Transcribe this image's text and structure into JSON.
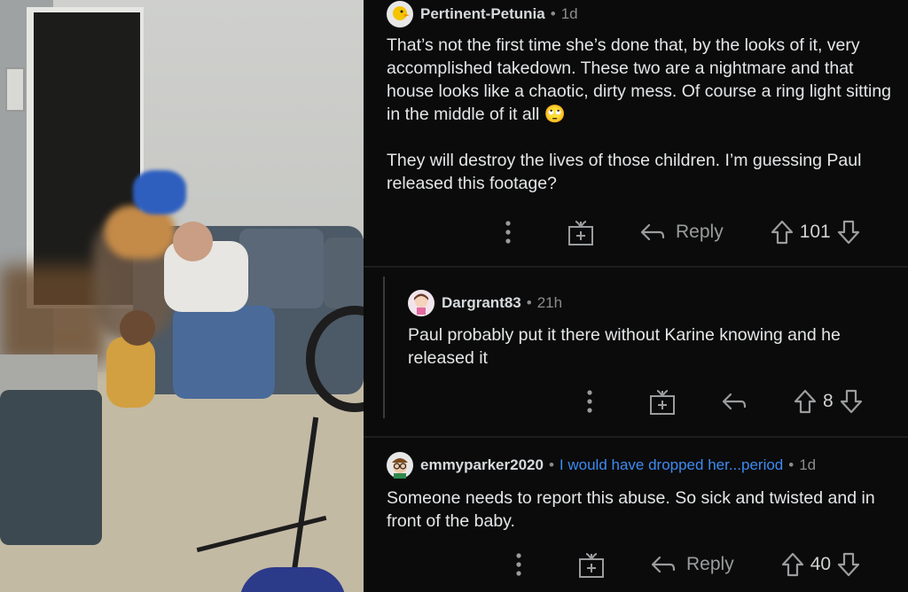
{
  "comments": [
    {
      "username": "Pertinent-Petunia",
      "separator": "•",
      "time": "1d",
      "avatar_icon": "duck-avatar-icon",
      "body_p1": "That’s not the first time she’s done that, by the looks of it, very accomplished takedown. These two are a nightmare and that house looks like a chaotic, dirty mess.  Of course a ring light sitting in the middle of it all",
      "emoji": "🙄",
      "body_p2": "They will destroy the lives of those children. I’m guessing Paul released this footage?",
      "reply_label": "Reply",
      "votes": "101"
    },
    {
      "username": "Dargrant83",
      "separator": "•",
      "time": "21h",
      "avatar_icon": "girl-avatar-icon",
      "body": "Paul probably put it there without Karine knowing and he released it",
      "votes": "8"
    },
    {
      "username": "emmyparker2020",
      "separator": "•",
      "flair": "I would have dropped her...period",
      "time": "1d",
      "avatar_icon": "glasses-avatar-icon",
      "body": "Someone needs to report this abuse. So sick and twisted and in front of the baby.",
      "reply_label": "Reply",
      "votes": "40"
    }
  ],
  "colors": {
    "background": "#0b0b0b",
    "text": "#e4e6e8",
    "muted": "#8a8c8e",
    "flair": "#3d8bf2"
  }
}
